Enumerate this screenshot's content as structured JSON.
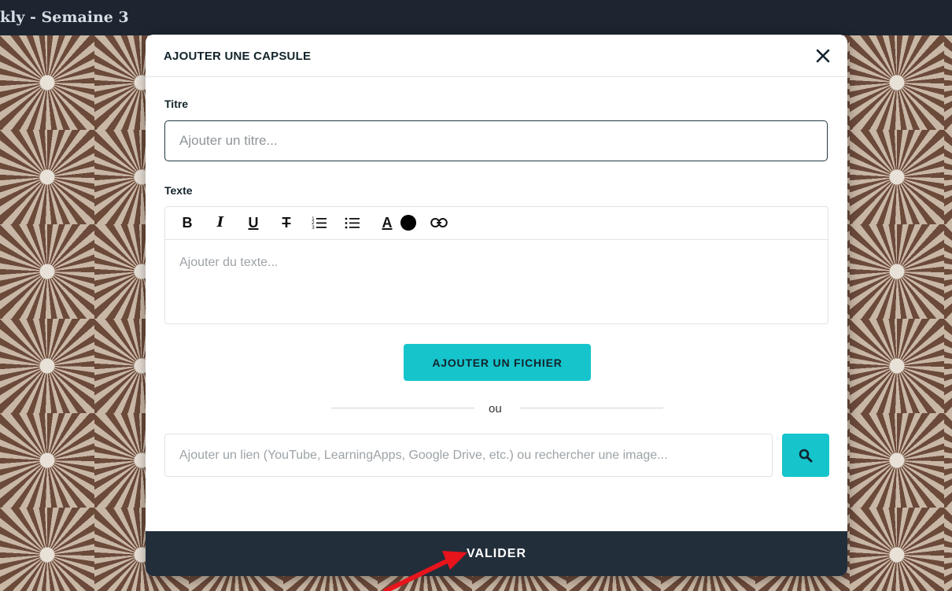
{
  "topbar": {
    "title": "kly - Semaine 3"
  },
  "modal": {
    "title": "AJOUTER UNE CAPSULE",
    "title_field": {
      "label": "Titre",
      "placeholder": "Ajouter un titre..."
    },
    "text_field": {
      "label": "Texte",
      "placeholder": "Ajouter du texte...",
      "toolbar": {
        "bold": "B",
        "italic": "I",
        "underline": "U",
        "strikethrough": "T",
        "text_color": "A"
      }
    },
    "file_button": "AJOUTER UN FICHIER",
    "separator": "ou",
    "link_field": {
      "placeholder": "Ajouter un lien (YouTube, LearningApps, Google Drive, etc.) ou rechercher une image..."
    },
    "submit": "VALIDER"
  },
  "colors": {
    "accent": "#16c4cc",
    "footer": "#232e3b",
    "topbar": "#1d2530",
    "annotation_arrow": "#e8141c"
  }
}
